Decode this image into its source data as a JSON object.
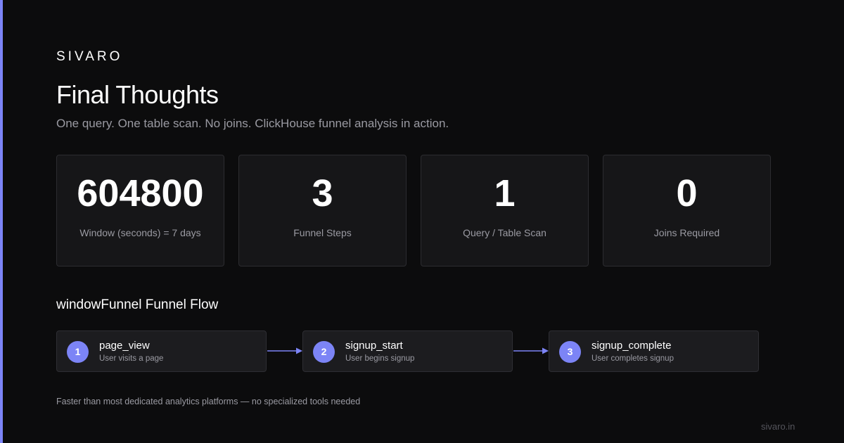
{
  "brand": "SIVARO",
  "title": "Final Thoughts",
  "subtitle": "One query. One table scan. No joins. ClickHouse funnel analysis in action.",
  "stats": [
    {
      "value": "604800",
      "label": "Window (seconds) = 7 days"
    },
    {
      "value": "3",
      "label": "Funnel Steps"
    },
    {
      "value": "1",
      "label": "Query / Table Scan"
    },
    {
      "value": "0",
      "label": "Joins Required"
    }
  ],
  "funnel": {
    "title": "windowFunnel Funnel Flow",
    "steps": [
      {
        "num": "1",
        "name": "page_view",
        "desc": "User visits a page"
      },
      {
        "num": "2",
        "name": "signup_start",
        "desc": "User begins signup"
      },
      {
        "num": "3",
        "name": "signup_complete",
        "desc": "User completes signup"
      }
    ]
  },
  "footnote": "Faster than most dedicated analytics platforms — no specialized tools needed",
  "site": "sivaro.in",
  "colors": {
    "accent": "#7c84f6",
    "background": "#0c0c0d",
    "card": "#161618",
    "muted_text": "#9a9aa2"
  },
  "icons": {
    "arrow": "arrow-right-icon"
  }
}
